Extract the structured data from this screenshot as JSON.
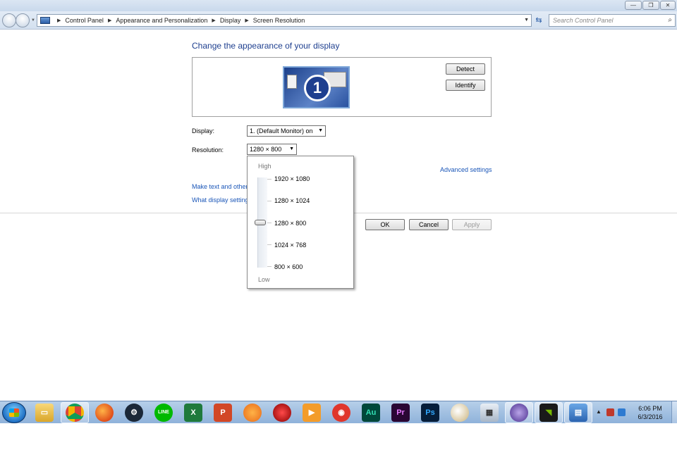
{
  "window": {
    "minimize": "—",
    "maximize": "❐",
    "close": "✕"
  },
  "nav": {
    "breadcrumbs": [
      "Control Panel",
      "Appearance and Personalization",
      "Display",
      "Screen Resolution"
    ],
    "search_placeholder": "Search Control Panel"
  },
  "main": {
    "title": "Change the appearance of your display",
    "monitor_number": "1",
    "detect_label": "Detect",
    "identify_label": "Identify",
    "display_label": "Display:",
    "display_value": "1. (Default Monitor) on",
    "resolution_label": "Resolution:",
    "resolution_value": "1280 × 800",
    "advanced_settings": "Advanced settings",
    "link_text_size": "Make text and other",
    "link_what_settings": "What display setting",
    "ok_label": "OK",
    "cancel_label": "Cancel",
    "apply_label": "Apply"
  },
  "resolution_dropdown": {
    "high_label": "High",
    "low_label": "Low",
    "options": [
      "1920 × 1080",
      "1280 × 1024",
      "1280 × 800",
      "1024 × 768",
      "800 × 600"
    ],
    "selected": "1280 × 800"
  },
  "taskbar": {
    "apps": [
      "windows-explorer",
      "chrome",
      "firefox",
      "steam",
      "line",
      "excel",
      "powerpoint",
      "app-orange",
      "app-red",
      "media-player",
      "app-camera",
      "audition",
      "premiere",
      "photoshop",
      "paint",
      "calculator",
      "app-circle",
      "nvidia",
      "control-panel"
    ],
    "clock_time": "6:06 PM",
    "clock_date": "6/3/2016"
  },
  "colors": {
    "link": "#1a56b8",
    "title": "#1e3f8f"
  }
}
